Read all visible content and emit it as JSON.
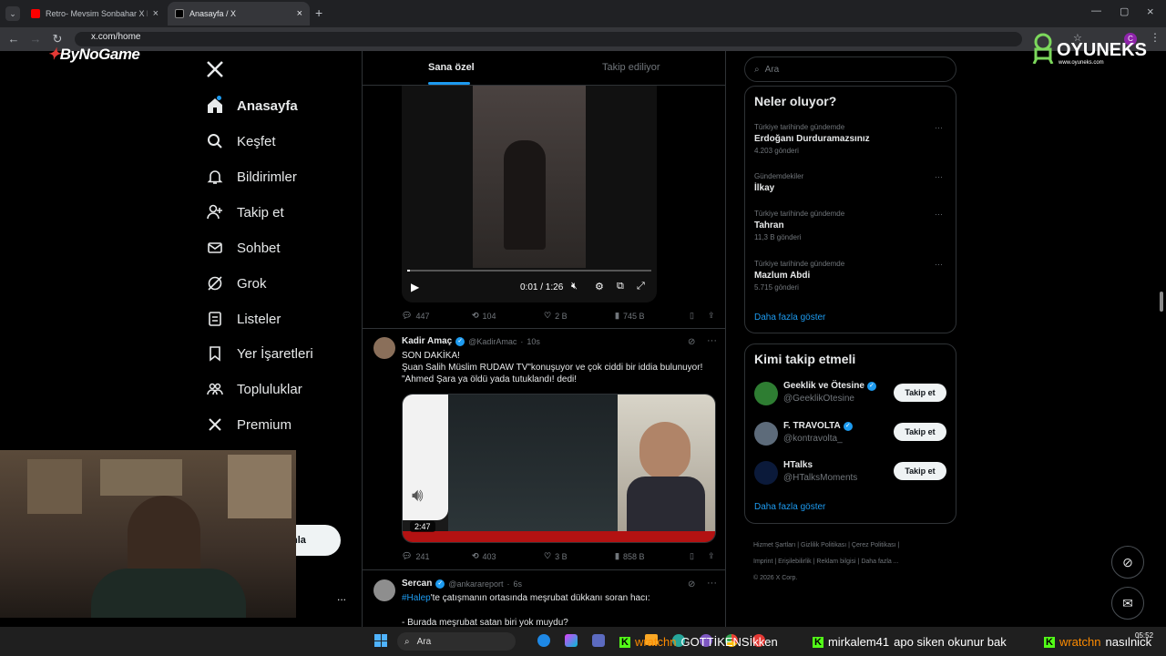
{
  "browser": {
    "tabs": [
      {
        "label": "Retro- Mevsim Sonbahar X MV"
      },
      {
        "label": "Anasayfa / X"
      }
    ],
    "url": "x.com/home"
  },
  "overlay": {
    "left_logo": "ByNoGame",
    "right_logo": "OYUNEKS",
    "right_logo_sub": "www.oyuneks.com"
  },
  "nav": {
    "items": [
      {
        "label": "Anasayfa",
        "icon": "home-icon"
      },
      {
        "label": "Keşfet",
        "icon": "search-icon"
      },
      {
        "label": "Bildirimler",
        "icon": "bell-icon"
      },
      {
        "label": "Takip et",
        "icon": "person-add-icon"
      },
      {
        "label": "Sohbet",
        "icon": "mail-icon"
      },
      {
        "label": "Grok",
        "icon": "grok-icon"
      },
      {
        "label": "Listeler",
        "icon": "list-icon"
      },
      {
        "label": "Yer İşaretleri",
        "icon": "bookmark-icon"
      },
      {
        "label": "Topluluklar",
        "icon": "communities-icon"
      },
      {
        "label": "Premium",
        "icon": "x-icon"
      }
    ],
    "post_button": "nla",
    "more": "..."
  },
  "feed": {
    "tabs": [
      "Sana özel",
      "Takip ediliyor"
    ],
    "video1": {
      "time": "0:01 / 1:26"
    },
    "post0_stats": {
      "replies": "447",
      "reposts": "104",
      "likes": "2 B",
      "views": "745 B"
    },
    "post1": {
      "name": "Kadir Amaç",
      "handle": "@KadirAmac",
      "time": "10s",
      "lines": [
        "SON DAKİKA!",
        "Şuan Salih Müslim RUDAW TV\"konuşuyor ve çok ciddi bir iddia bulunuyor!",
        "\"Ahmed Şara ya öldü yada tutuklandı! dedi!"
      ],
      "duration": "2:47",
      "stats": {
        "replies": "241",
        "reposts": "403",
        "likes": "3 B",
        "views": "858 B"
      }
    },
    "post2": {
      "name": "Sercan",
      "handle": "@ankarareport",
      "time": "6s",
      "hashtag": "#Halep",
      "line1": "'te çatışmanın ortasında meşrubat dükkanı soran hacı:",
      "line2": "- Burada meşrubat satan biri yok muydu?"
    }
  },
  "right": {
    "search_placeholder": "Ara",
    "trends_title": "Neler oluyor?",
    "trends": [
      {
        "meta": "Türkiye tarihinde gündemde",
        "title": "Erdoğanı Durduramazsınız",
        "count": "4.203 gönderi"
      },
      {
        "meta": "Gündemdekiler",
        "title": "İlkay",
        "count": ""
      },
      {
        "meta": "Türkiye tarihinde gündemde",
        "title": "Tahran",
        "count": "11,3 B gönderi"
      },
      {
        "meta": "Türkiye tarihinde gündemde",
        "title": "Mazlum Abdi",
        "count": "5.715 gönderi"
      }
    ],
    "show_more": "Daha fazla göster",
    "follow_title": "Kimi takip etmeli",
    "follow": [
      {
        "name": "Geeklik ve Ötesine",
        "handle": "@GeeklikOtesine",
        "verified": true
      },
      {
        "name": "F. TRAVOLTA",
        "handle": "@kontravolta_",
        "verified": true
      },
      {
        "name": "HTalks",
        "handle": "@HTalksMoments",
        "verified": false
      }
    ],
    "follow_button": "Takip et",
    "footer": [
      "Hizmet Şartları",
      "Gizlilik Politikası",
      "Çerez Politikası",
      "Imprint",
      "Erişilebilirlik",
      "Reklam bilgisi",
      "Daha fazla ...",
      "© 2026 X Corp."
    ]
  },
  "taskbar": {
    "search": "Ara",
    "chat": [
      {
        "user": "wratchn",
        "msg": "GOTTİKENSİkken"
      },
      {
        "user": "mirkalem41",
        "msg": "apo siken okunur bak"
      },
      {
        "user": "wratchn",
        "msg": "nasılnick"
      }
    ],
    "time": "05:52"
  },
  "colors": {
    "accent": "#1d9bf0",
    "bg": "#000000",
    "border": "#2f3336",
    "muted": "#71767b"
  }
}
